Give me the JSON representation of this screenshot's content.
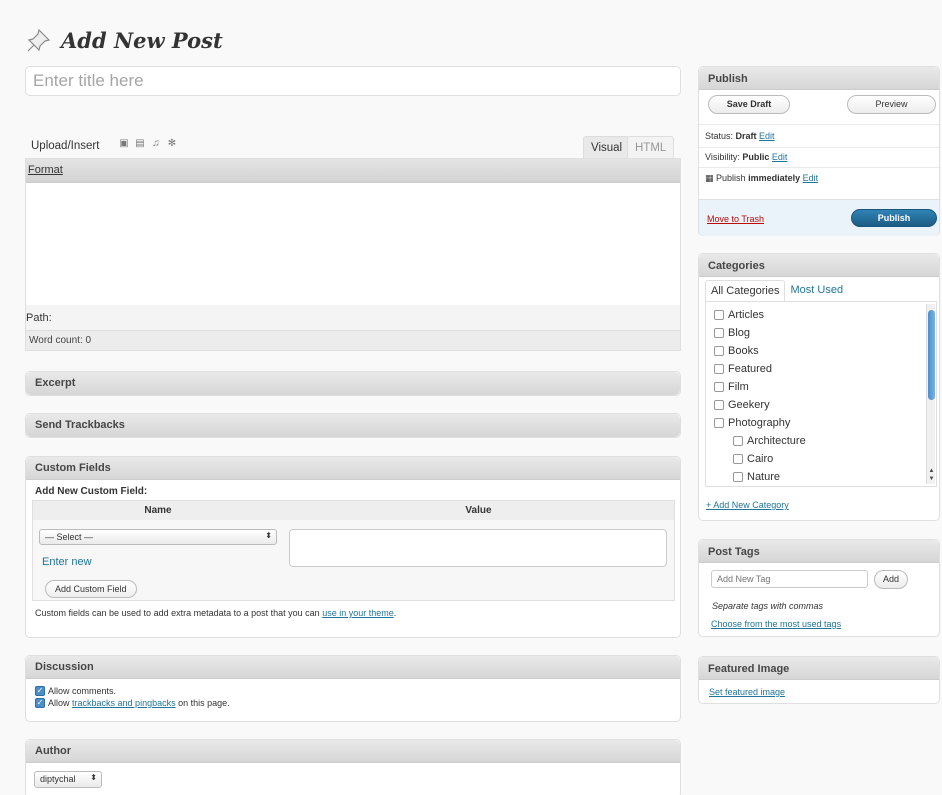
{
  "header": {
    "title": "Add New Post"
  },
  "title_field": {
    "placeholder": "Enter title here"
  },
  "editor": {
    "upload_label": "Upload/Insert",
    "media_icons": [
      "image-icon",
      "video-icon",
      "audio-icon",
      "media-icon"
    ],
    "tab_visual": "Visual",
    "tab_html": "HTML",
    "format_label": "Format",
    "path_label": "Path:",
    "word_count": "Word count: 0"
  },
  "boxes": {
    "excerpt": "Excerpt",
    "trackbacks": "Send Trackbacks",
    "custom_fields": {
      "title": "Custom Fields",
      "add_new_label": "Add New Custom Field:",
      "col_name": "Name",
      "col_value": "Value",
      "select_value": "— Select —",
      "enter_new": "Enter new",
      "add_button": "Add Custom Field",
      "note_prefix": "Custom fields can be used to add extra metadata to a post that you can ",
      "note_link": "use in your theme",
      "note_suffix": "."
    },
    "discussion": {
      "title": "Discussion",
      "allow_comments": "Allow comments.",
      "allow_prefix": "Allow ",
      "allow_link": "trackbacks and pingbacks",
      "allow_suffix": " on this page."
    },
    "author": {
      "title": "Author",
      "selected": "diptychal"
    }
  },
  "publish": {
    "title": "Publish",
    "save_draft": "Save Draft",
    "preview": "Preview",
    "status_label": "Status: ",
    "status_value": "Draft",
    "visibility_label": "Visibility: ",
    "visibility_value": "Public",
    "edit": "Edit",
    "publish_label": "Publish ",
    "publish_value": "immediately",
    "move_to_trash": "Move to Trash",
    "publish_button": "Publish"
  },
  "categories": {
    "title": "Categories",
    "tab_all": "All Categories",
    "tab_most_used": "Most Used",
    "items": [
      {
        "label": "Articles",
        "child": false
      },
      {
        "label": "Blog",
        "child": false
      },
      {
        "label": "Books",
        "child": false
      },
      {
        "label": "Featured",
        "child": false
      },
      {
        "label": "Film",
        "child": false
      },
      {
        "label": "Geekery",
        "child": false
      },
      {
        "label": "Photography",
        "child": false
      },
      {
        "label": "Architecture",
        "child": true
      },
      {
        "label": "Cairo",
        "child": true
      },
      {
        "label": "Nature",
        "child": true
      }
    ],
    "add_new": "+ Add New Category"
  },
  "tags": {
    "title": "Post Tags",
    "placeholder": "Add New Tag",
    "add_button": "Add",
    "note": "Separate tags with commas",
    "choose_link": "Choose from the most used tags"
  },
  "featured_image": {
    "title": "Featured Image",
    "set_link": "Set featured image"
  },
  "colors": {
    "link": "#21759b",
    "publish_button": "#1d5b86",
    "trash": "#bc0b0b"
  }
}
